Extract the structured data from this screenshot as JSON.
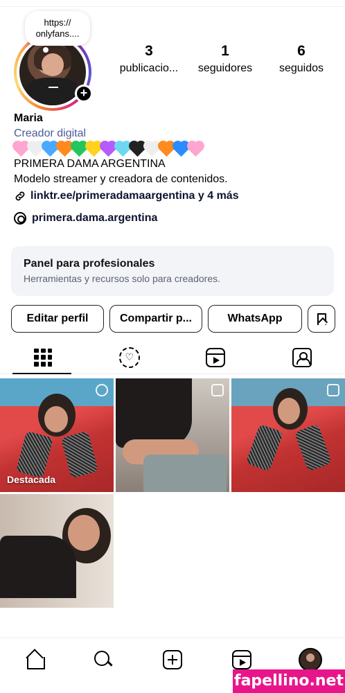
{
  "note": {
    "text": "https://\nonlyfans...."
  },
  "stats": [
    {
      "value": "3",
      "label": "publicacio..."
    },
    {
      "value": "1",
      "label": "seguidores"
    },
    {
      "value": "6",
      "label": "seguidos"
    }
  ],
  "profile": {
    "name": "Maria",
    "category": "Creador digital",
    "hearts": [
      "#ffa6d0",
      "#eeeeee",
      "#4aa8ff",
      "#ff8a1f",
      "#22c55e",
      "#ffd21f",
      "#b45cff",
      "#6fd8f0",
      "#222222",
      "#eeeeee",
      "#ff8a1f",
      "#2b8cff",
      "#ffa6d0"
    ],
    "bio_line1": "PRIMERA DAMA ARGENTINA",
    "bio_line2": "Modelo streamer y creadora de contenidos.",
    "link": "linktr.ee/primeradamaargentina y 4 más",
    "threads": "primera.dama.argentina"
  },
  "panel": {
    "title": "Panel para profesionales",
    "subtitle": "Herramientas y recursos solo para creadores."
  },
  "buttons": {
    "edit": "Editar perfil",
    "share": "Compartir p...",
    "whatsapp": "WhatsApp"
  },
  "grid": {
    "featured_label": "Destacada"
  },
  "watermark": "fapellino.net"
}
